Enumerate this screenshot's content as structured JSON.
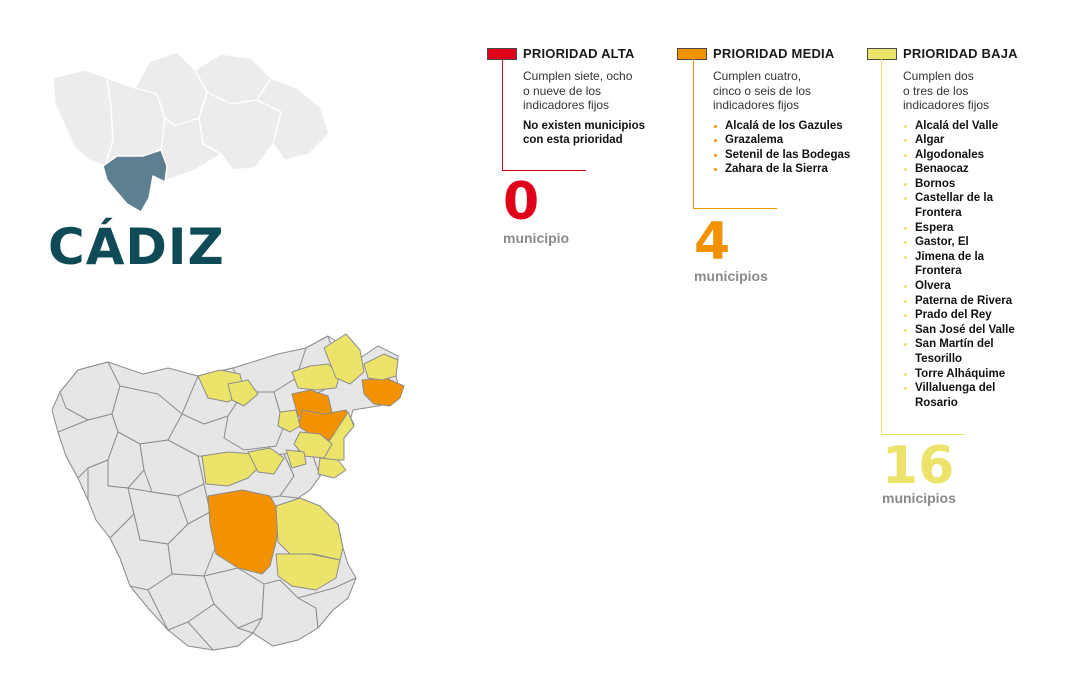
{
  "province": "CÁDIZ",
  "legend": {
    "alta": {
      "title": "PRIORIDAD ALTA",
      "color": "#e1001a",
      "description": "Cumplen siete, ocho\no nueve  de los\nindicadores fijos",
      "note": "No existen municipios\ncon esta prioridad",
      "count": "0",
      "count_label": "municipio",
      "municipalities": []
    },
    "media": {
      "title": "PRIORIDAD MEDIA",
      "color": "#f39200",
      "description": "Cumplen cuatro,\ncinco o seis de los\nindicadores fijos",
      "count": "4",
      "count_label": "municipios",
      "municipalities": [
        "Alcalá de los Gazules",
        "Grazalema",
        "Setenil de las Bodegas",
        "Zahara de la Sierra"
      ]
    },
    "baja": {
      "title": "PRIORIDAD BAJA",
      "color": "#ece46a",
      "description": "Cumplen dos\no tres de los\nindicadores fijos",
      "count": "16",
      "count_label": "municipios",
      "municipalities": [
        "Alcalá del Valle",
        "Algar",
        "Algodonales",
        "Benaocaz",
        "Bornos",
        "Castellar de la Frontera",
        "Espera",
        "Gastor, El",
        "Jimena de la Frontera",
        "Olvera",
        "Paterna de Rivera",
        "Prado del Rey",
        "San José del Valle",
        "San Martín del Tesorillo",
        "Torre Alháquime",
        "Villaluenga del Rosario"
      ]
    }
  },
  "colors": {
    "province_title": "#0f4a57",
    "locator_highlight": "#5e7f8f",
    "locator_base": "#ececec",
    "no_priority": "#e6e6e6",
    "count_label": "#8a8a8a"
  }
}
